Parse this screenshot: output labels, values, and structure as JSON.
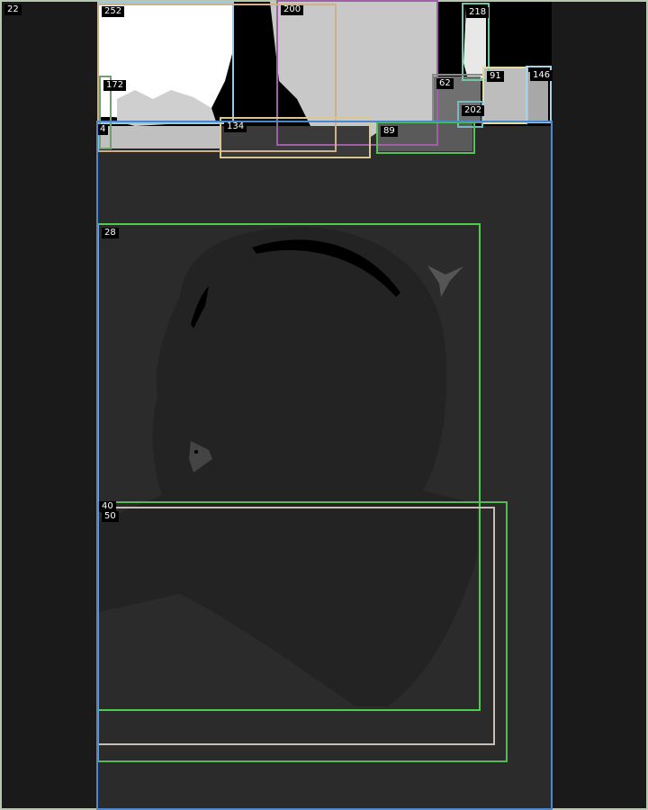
{
  "title": "",
  "image_description_hidden": false,
  "segments": [
    {
      "id": "22",
      "color": "#b8c8b0"
    },
    {
      "id": "252",
      "color": "#9ac8e8"
    },
    {
      "id": "200",
      "color": "#a060a8"
    },
    {
      "id": "218",
      "color": "#6ec8a0"
    },
    {
      "id": "62",
      "color": "#8a8a8a"
    },
    {
      "id": "91",
      "color": "#e0dca0"
    },
    {
      "id": "146",
      "color": "#a8d0e8"
    },
    {
      "id": "172",
      "color": "#70a070"
    },
    {
      "id": "202",
      "color": "#78b8c0"
    },
    {
      "id": "4",
      "color": "#d0b088"
    },
    {
      "id": "134",
      "color": "#d8c890"
    },
    {
      "id": "89",
      "color": "#58c058"
    },
    {
      "id": "28",
      "color": "#48d048"
    },
    {
      "id": "50",
      "color": "#c8c0b8"
    },
    {
      "id": "40",
      "color": "#58b858"
    },
    {
      "id": "main-panel",
      "color": "#4a88d0"
    }
  ]
}
